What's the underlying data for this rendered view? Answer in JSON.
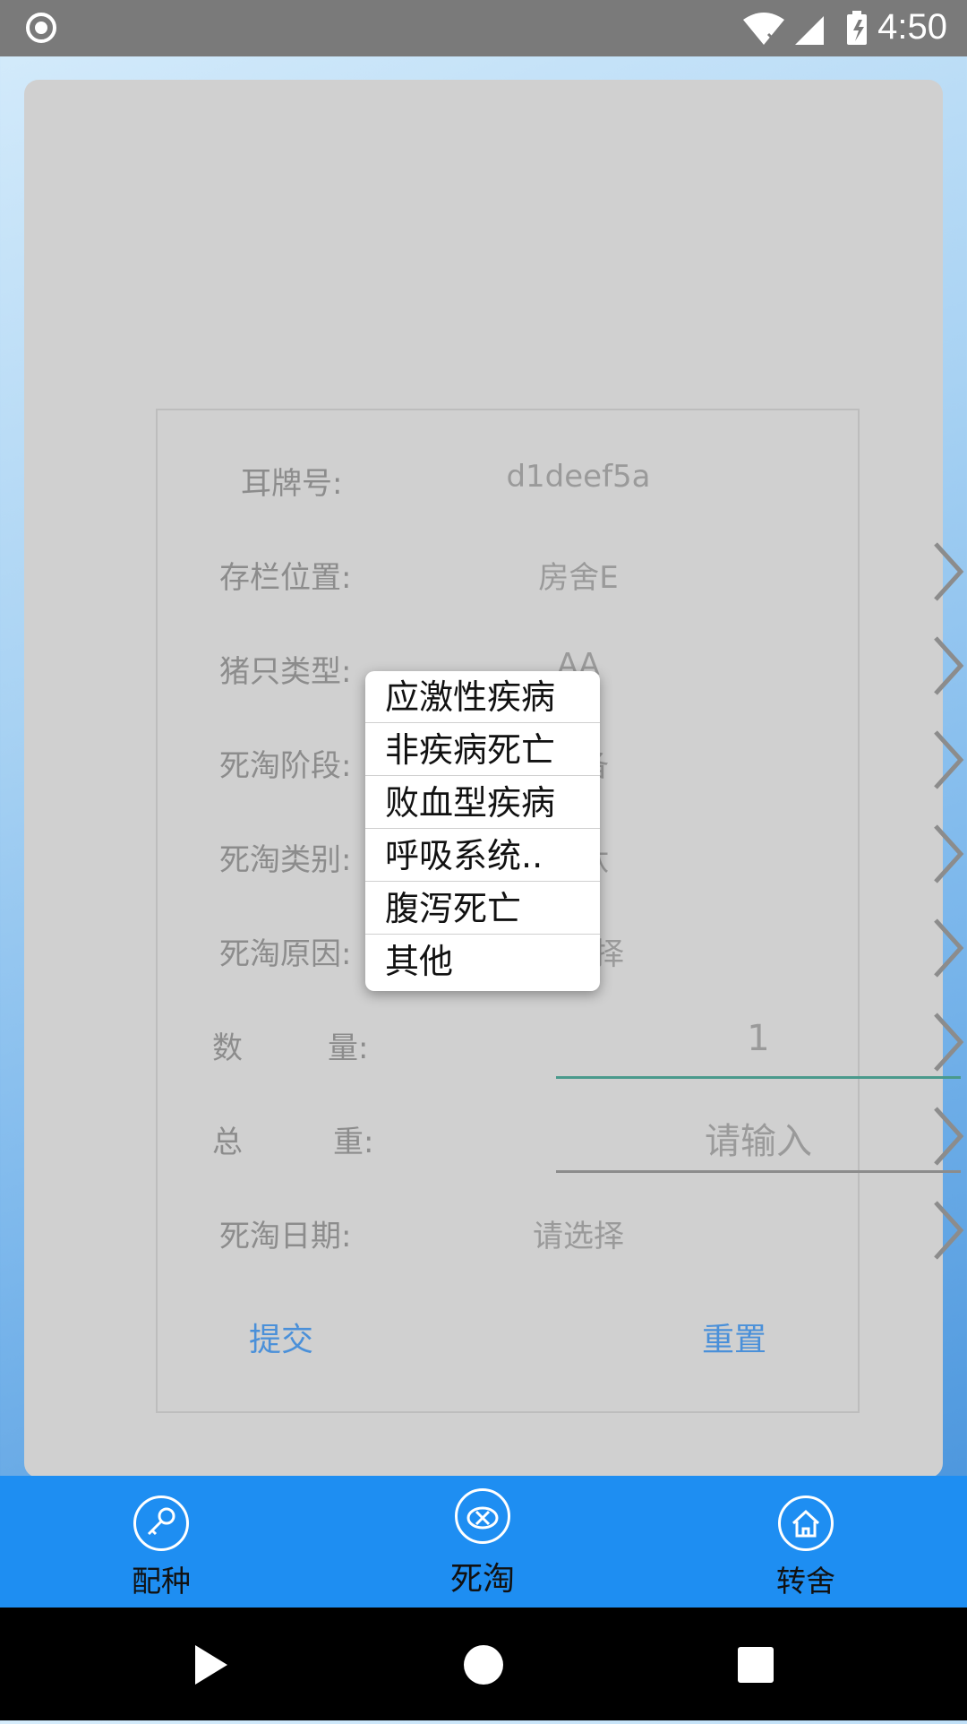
{
  "status_bar": {
    "time": "4:50",
    "colors": {
      "bg": "#7a7a7a"
    }
  },
  "form": {
    "rows": [
      {
        "label": "耳牌号:",
        "value": "d1deef5a"
      },
      {
        "label": "存栏位置:",
        "value": "房舍E"
      },
      {
        "label": "猪只类型:",
        "value": "AA"
      },
      {
        "label": "死淘阶段:",
        "value": "后备"
      },
      {
        "label": "死淘类别:",
        "value": "淘汰"
      },
      {
        "label": "死淘原因:",
        "value": "请选择"
      },
      {
        "label_a": "数",
        "label_b": "量:",
        "value": "1"
      },
      {
        "label_a": "总",
        "label_b": "重:",
        "value": "请输入"
      },
      {
        "label": "死淘日期:",
        "value": "请选择"
      }
    ],
    "submit": "提交",
    "reset": "重置"
  },
  "popup": {
    "items": [
      "应激性疾病",
      "非疾病死亡",
      "败血型疾病",
      "呼吸系统..",
      "腹泻死亡",
      "其他"
    ]
  },
  "tabs": [
    {
      "label": "配种",
      "icon": "breeding-icon"
    },
    {
      "label": "死淘",
      "icon": "pig-cull-icon"
    },
    {
      "label": "转舍",
      "icon": "house-transfer-icon"
    }
  ],
  "colors": {
    "accent": "#1e8ef2",
    "link": "#4a90d9",
    "underline_active": "#4a9a8c"
  }
}
